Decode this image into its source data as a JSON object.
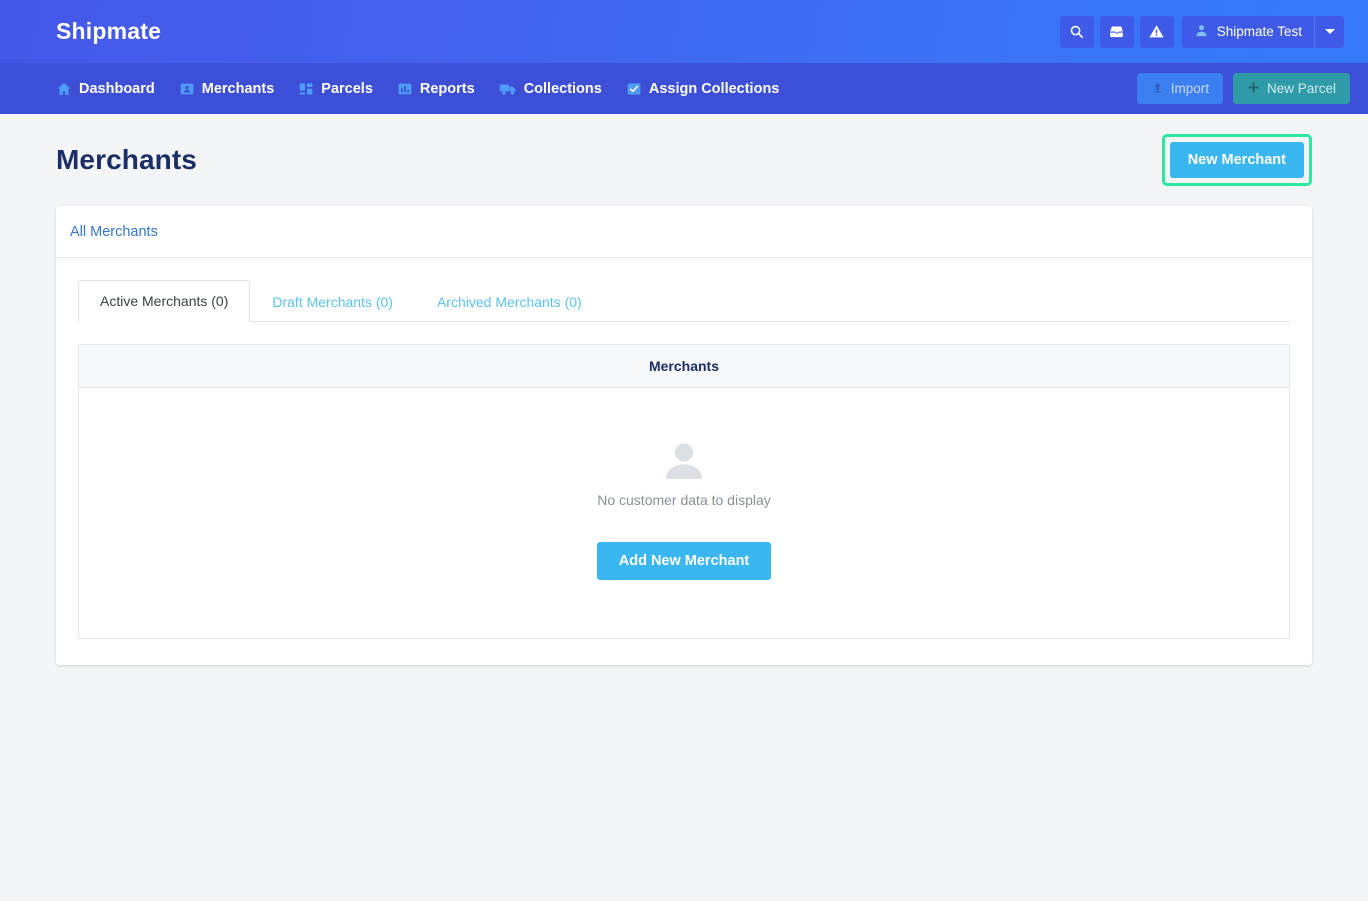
{
  "topbar": {
    "brand": "Shipmate",
    "actions": [
      {
        "name": "search-icon",
        "label": "Search"
      },
      {
        "name": "inbox-icon",
        "label": "Inbox"
      },
      {
        "name": "alert-icon",
        "label": "Alerts"
      }
    ],
    "user": {
      "name": "Shipmate Test",
      "avatar_icon": "person-icon",
      "caret_icon": "caret-down-icon"
    },
    "colors": {
      "gradient_start": "#4457e8",
      "gradient_end": "#3579f8",
      "button_bg": "#3f5ae6"
    }
  },
  "nav": {
    "items": [
      {
        "label": "Dashboard",
        "icon": "home-icon"
      },
      {
        "label": "Merchants",
        "icon": "contact-card-icon"
      },
      {
        "label": "Parcels",
        "icon": "grid-icon"
      },
      {
        "label": "Reports",
        "icon": "bar-chart-icon"
      },
      {
        "label": "Collections",
        "icon": "truck-icon"
      },
      {
        "label": "Assign Collections",
        "icon": "check-square-icon"
      }
    ],
    "import_label": "Import",
    "import_icon": "upload-icon",
    "new_parcel_label": "New Parcel",
    "new_parcel_icon": "plus-icon",
    "colors": {
      "bar_bg": "#3d4fd6",
      "icon": "#4d9cf7",
      "import_bg": "#3b7ff0",
      "new_parcel_bg": "#2f9aa8"
    }
  },
  "page": {
    "title": "Merchants",
    "new_merchant_label": "New Merchant",
    "highlight_color": "#2ce8a0",
    "primary_button_color": "#3ab6f0",
    "title_color": "#1b2f66"
  },
  "card": {
    "header_title": "All Merchants",
    "header_title_color": "#3577cc",
    "tabs": [
      {
        "label": "Active Merchants (0)",
        "active": true
      },
      {
        "label": "Draft Merchants (0)",
        "active": false
      },
      {
        "label": "Archived Merchants (0)",
        "active": false
      }
    ],
    "table": {
      "columns": [
        "Merchants"
      ],
      "rows": [],
      "empty_state": {
        "icon": "person-placeholder-icon",
        "text": "No customer data to display",
        "action_label": "Add New Merchant"
      }
    }
  }
}
